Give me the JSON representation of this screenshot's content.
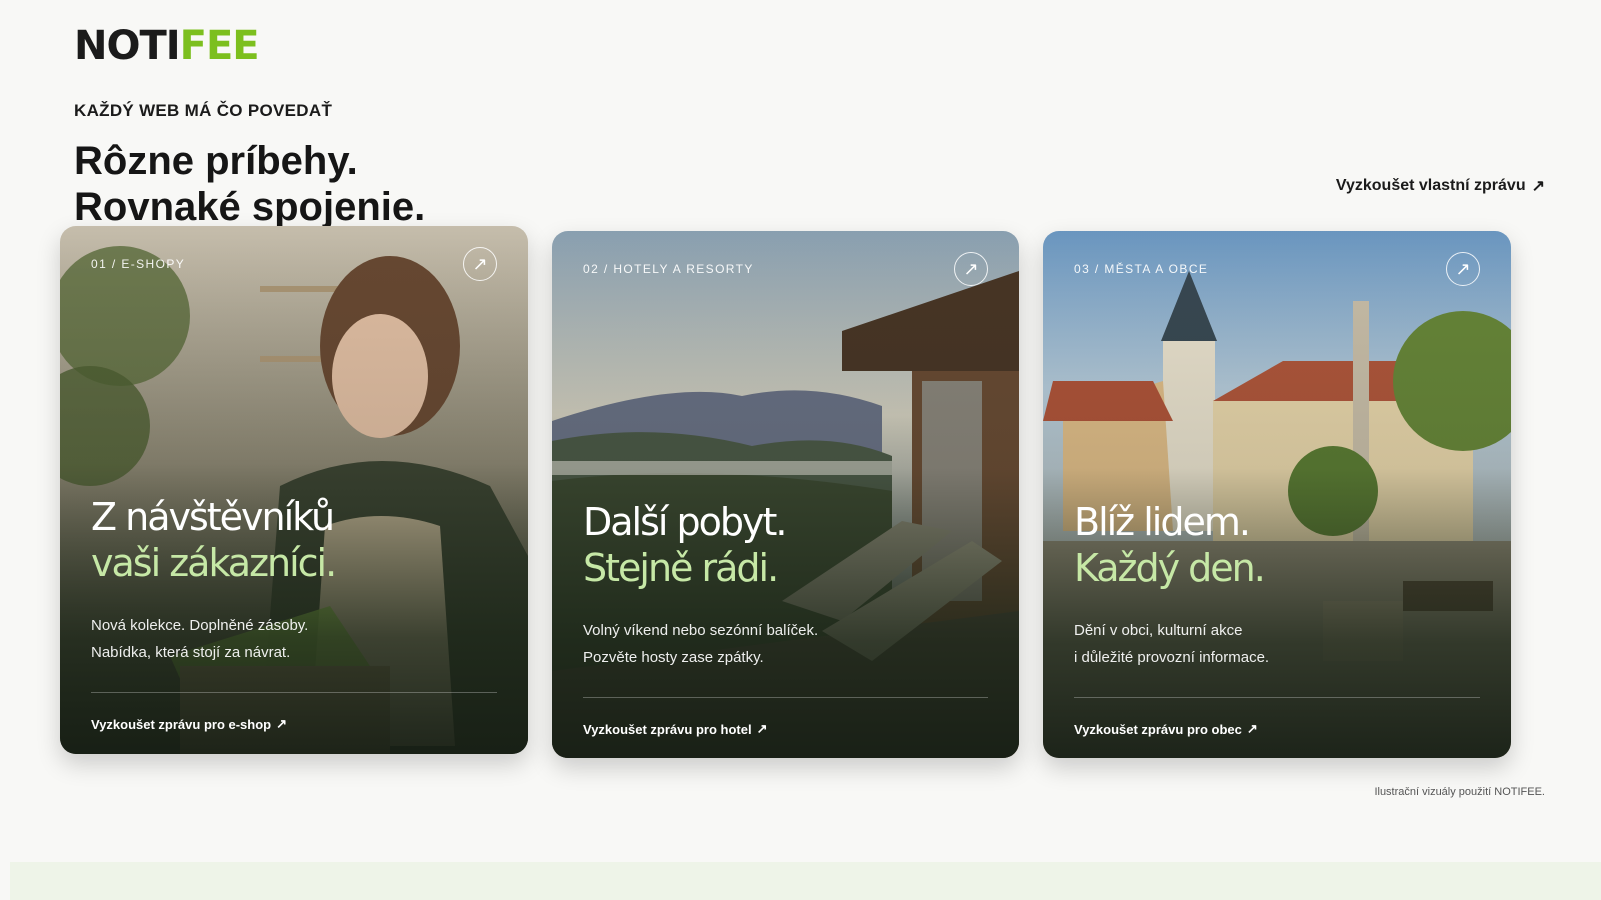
{
  "logo": {
    "part1": "NOTI",
    "part2": "FEE"
  },
  "intro": {
    "eyebrow": "KAŽDÝ WEB MÁ ČO POVEDAŤ",
    "headline_line1": "Rôzne príbehy.",
    "headline_line2": "Rovnaké spojenie."
  },
  "top_cta": {
    "label": "Vyzkoušet vlastní zprávu",
    "icon": "arrow-up-right-icon"
  },
  "cards": [
    {
      "tag": "01 / E-SHOPY",
      "title_line1": "Z návštěvníků",
      "title_line2": "vaši zákazníci.",
      "desc_line1": "Nová kolekce. Doplněné zásoby.",
      "desc_line2": "Nabídka, která stojí za návrat.",
      "cta": "Vyzkoušet zprávu pro e-shop",
      "image": "woman-packing-parcel-photo"
    },
    {
      "tag": "02 / HOTELY A RESORTY",
      "title_line1": "Další pobyt.",
      "title_line2": "Stejně rádi.",
      "desc_line1": "Volný víkend nebo sezónní balíček.",
      "desc_line2": "Pozvěte hosty zase zpátky.",
      "cta": "Vyzkoušet zprávu pro hotel",
      "image": "mountain-terrace-photo"
    },
    {
      "tag": "03 / MĚSTA A OBCE",
      "title_line1": "Blíž lidem.",
      "title_line2": "Každý den.",
      "desc_line1": "Dění v obci, kulturní akce",
      "desc_line2": "i důležité provozní informace.",
      "cta": "Vyzkoušet zprávu pro obec",
      "image": "town-square-photo"
    }
  ],
  "credit": "Ilustrační vizuály použití NOTIFEE.",
  "colors": {
    "accent": "#7cbf1e",
    "title_green": "#c6e8a6",
    "background": "#f8f8f6"
  }
}
